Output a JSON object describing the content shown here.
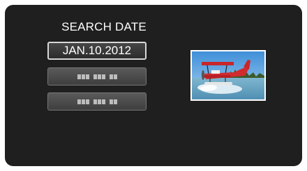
{
  "screen": {
    "title": "SEARCH DATE",
    "dates": [
      {
        "label": "JAN.10.2012",
        "selected": true
      },
      {
        "label": "",
        "placeholder": true
      },
      {
        "label": "",
        "placeholder": true
      }
    ],
    "thumbnail": {
      "icon": "seaplane-photo-icon"
    }
  },
  "colors": {
    "screen_background": "#1f1f1f",
    "button_border_selected": "#d8d8d8",
    "text": "#ffffff"
  }
}
